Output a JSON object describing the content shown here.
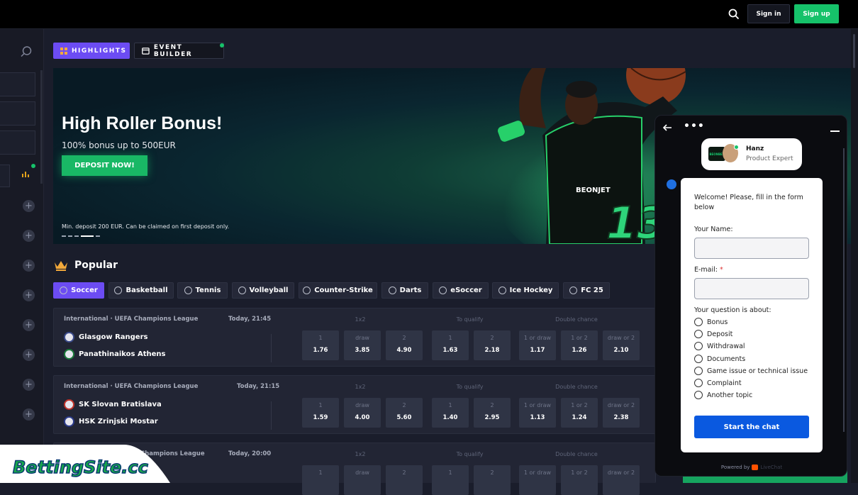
{
  "header": {
    "signin_label": "Sign in",
    "signup_label": "Sign up",
    "search_icon": "search-icon"
  },
  "tabs": {
    "highlights": "HIGHLIGHTS",
    "event_builder": "EVENT BUILDER"
  },
  "banner": {
    "title": "High Roller Bonus!",
    "subtitle": "100% bonus up to 500EUR",
    "cta": "DEPOSIT NOW!",
    "note": "Min. deposit 200 EUR. Can be claimed on first deposit only.",
    "jersey_number": "13",
    "jersey_brand": "BEONJET"
  },
  "popular": {
    "title": "Popular",
    "sports": [
      "Soccer",
      "Basketball",
      "Tennis",
      "Volleyball",
      "Counter-Strike",
      "Darts",
      "eSoccer",
      "Ice Hockey",
      "FC 25"
    ]
  },
  "market_headers": {
    "m1": "1x2",
    "m2": "To qualify",
    "m3": "Double chance"
  },
  "odd_labels": [
    "1",
    "draw",
    "2",
    "1",
    "2",
    "1 or draw",
    "1 or 2",
    "draw or 2"
  ],
  "matches": [
    {
      "league": "International · UEFA Champions League",
      "time": "Today, 21:45",
      "home": "Glasgow Rangers",
      "away": "Panathinaikos Athens",
      "odds": [
        "1.76",
        "3.85",
        "4.90",
        "1.63",
        "2.18",
        "1.17",
        "1.26",
        "2.10"
      ]
    },
    {
      "league": "International · UEFA Champions League",
      "time": "Today, 21:15",
      "home": "SK Slovan Bratislava",
      "away": "HSK Zrinjski Mostar",
      "odds": [
        "1.59",
        "4.00",
        "5.60",
        "1.40",
        "2.95",
        "1.13",
        "1.24",
        "2.38"
      ]
    },
    {
      "league": "Champions League",
      "time": "Today, 20:00"
    }
  ],
  "chat": {
    "agent_name": "Hanz",
    "agent_role": "Product Expert",
    "agent_logo": "BEONBET",
    "welcome": "Welcome! Please, fill in the form below",
    "name_label": "Your Name:",
    "email_label": "E-mail:",
    "required_mark": "*",
    "question_label": "Your question is about:",
    "topics": [
      "Bonus",
      "Deposit",
      "Withdrawal",
      "Documents",
      "Game issue or technical issue",
      "Complaint",
      "Another topic"
    ],
    "start_label": "Start the chat",
    "powered_by": "Powered by",
    "powered_brand": "LiveChat"
  },
  "watermark": {
    "text": "BettingSite.cc"
  },
  "colors": {
    "accent": "#6c4cf3",
    "green": "#16c26a",
    "chat_blue": "#0a59e0"
  }
}
